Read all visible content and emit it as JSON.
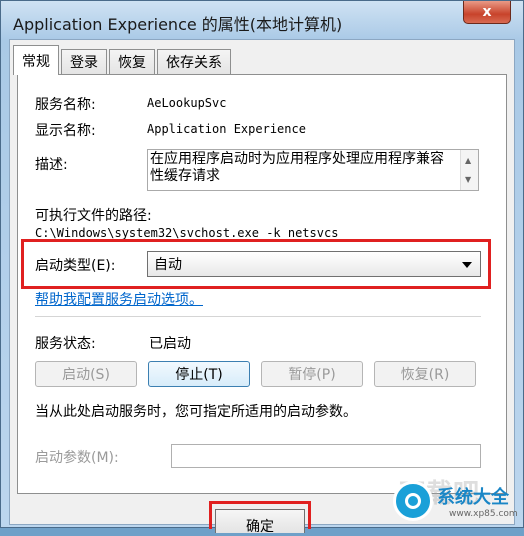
{
  "window": {
    "title": "Application Experience 的属性(本地计算机)",
    "close_label": "x"
  },
  "tabs": [
    {
      "label": "常规"
    },
    {
      "label": "登录"
    },
    {
      "label": "恢复"
    },
    {
      "label": "依存关系"
    }
  ],
  "general": {
    "service_name_label": "服务名称:",
    "service_name_value": "AeLookupSvc",
    "display_name_label": "显示名称:",
    "display_name_value": "Application Experience",
    "description_label": "描述:",
    "description_value": "在应用程序启动时为应用程序处理应用程序兼容性缓存请求",
    "exe_path_label": "可执行文件的路径:",
    "exe_path_value": "C:\\Windows\\system32\\svchost.exe -k netsvcs",
    "startup_type_label": "启动类型(E):",
    "startup_type_value": "自动",
    "help_link": "帮助我配置服务启动选项。",
    "status_label": "服务状态:",
    "status_value": "已启动",
    "start_button": "启动(S)",
    "stop_button": "停止(T)",
    "pause_button": "暂停(P)",
    "resume_button": "恢复(R)",
    "hint_text": "当从此处启动服务时，您可指定所适用的启动参数。",
    "params_label": "启动参数(M):",
    "params_value": ""
  },
  "footer": {
    "ok_button": "确定"
  },
  "watermark": {
    "text": "下载吧",
    "logo_text": "系统大全",
    "logo_url": "www.xp85.com"
  },
  "colors": {
    "highlight_box": "#e02020",
    "link": "#0066cc",
    "close_button": "#c8432b"
  }
}
